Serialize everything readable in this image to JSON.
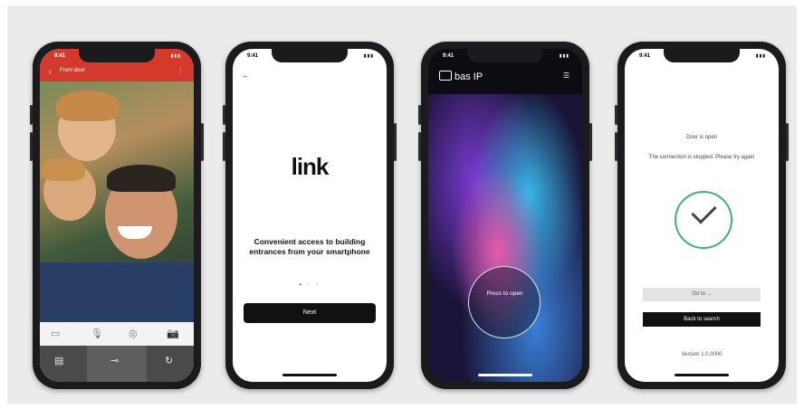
{
  "phone1": {
    "time": "9:41",
    "device_name": "Front door",
    "controls": [
      "▭",
      "🎙",
      "◎",
      "📷"
    ],
    "bottom": [
      "▤",
      "⊸",
      "↻"
    ],
    "colors": {
      "header": "#d33a2c"
    }
  },
  "phone2": {
    "time": "9:41",
    "logo": "link",
    "tagline": "Convenient access to building entrances from your smartphone",
    "dots": "● ○ ○",
    "next_label": "Next"
  },
  "phone3": {
    "time": "9:41",
    "brand": "bas IP",
    "press_label": "Press to open"
  },
  "phone4": {
    "time": "9:41",
    "status_title": "Door is open",
    "status_detail": "The connection is stopped. Please try again",
    "action1": "Go to ...",
    "action2": "Back to search",
    "version": "Version 1.0.0000"
  }
}
